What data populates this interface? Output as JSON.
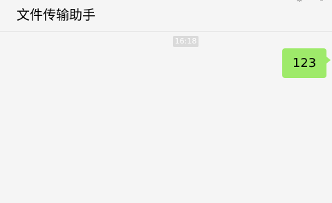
{
  "header": {
    "title": "文件传输助手",
    "pin_icon": "pin-icon",
    "minimize_icon": "minimize-icon"
  },
  "chat": {
    "messages": [
      {
        "timestamp": "16:18",
        "text": "123",
        "sender": "self",
        "bubble_color": "#9eea6a"
      }
    ]
  }
}
